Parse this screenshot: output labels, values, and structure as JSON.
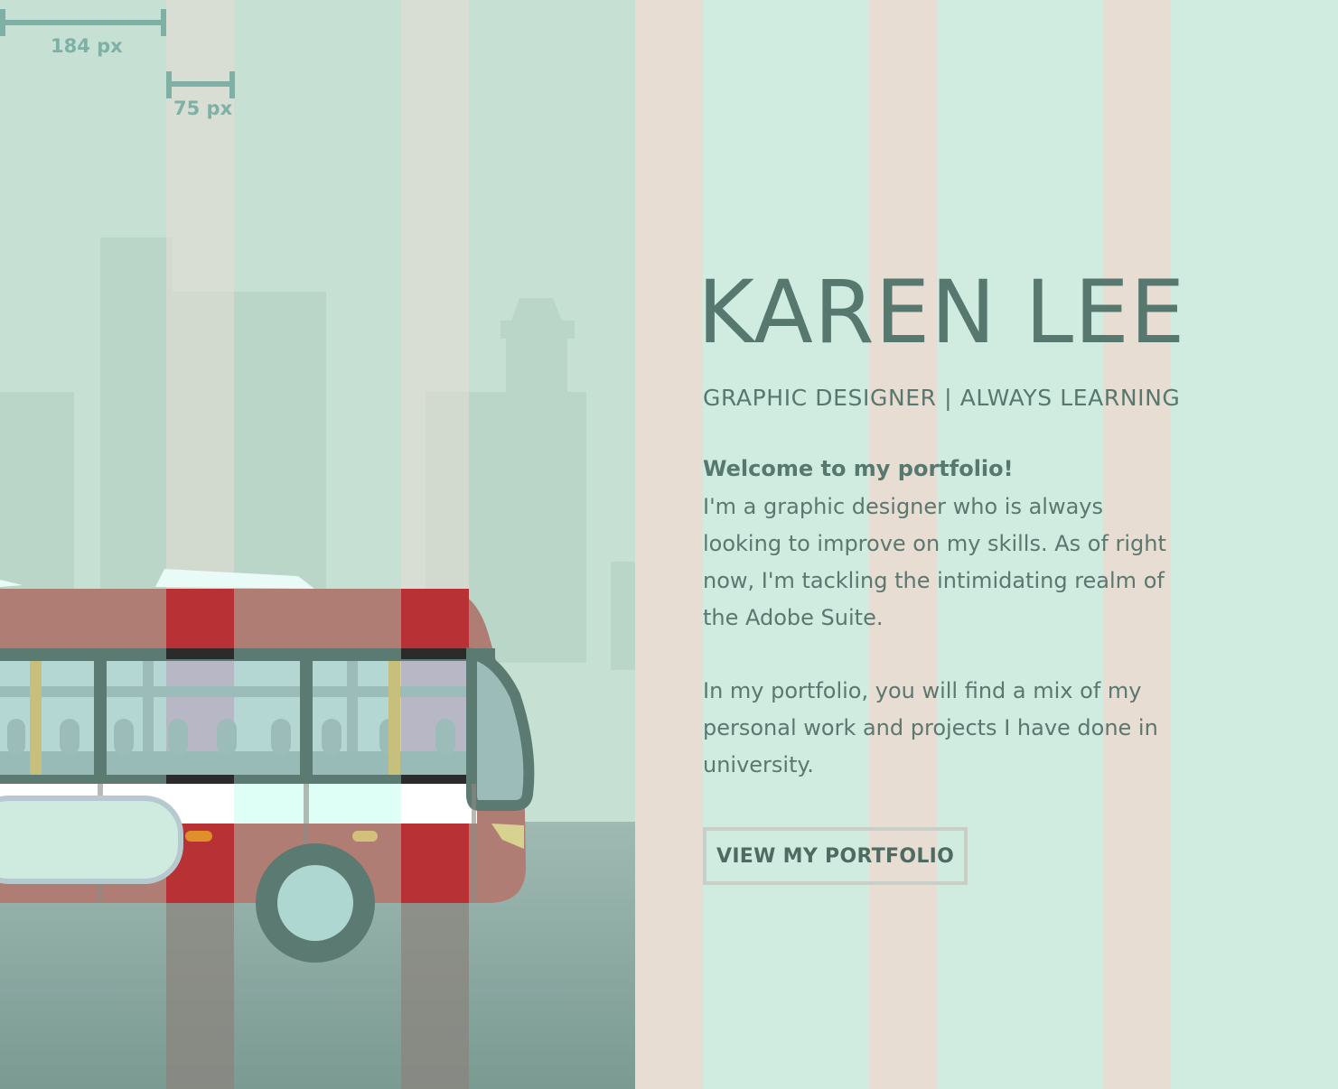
{
  "colors": {
    "background_mint": "#d0ebdf",
    "column_beige": "#e8ddd2",
    "text_green": "#57786f",
    "bus_red": "#b83235",
    "bus_trim": "#5b7a72"
  },
  "measurements": {
    "gutter_label": "184 px",
    "column_label": "75 px"
  },
  "hero": {
    "title": "KAREN LEE",
    "subtitle": "GRAPHIC DESIGNER | ALWAYS LEARNING",
    "welcome": "Welcome to my portfolio!",
    "paragraph_1": "I'm a graphic designer who is always looking to improve on my skills. As of right now, I'm tackling the intimidating realm of the Adobe Suite.",
    "paragraph_2": "In my portfolio, you will find a mix of my personal work and projects I have done in university.",
    "cta_label": "VIEW MY PORTFOLIO"
  }
}
